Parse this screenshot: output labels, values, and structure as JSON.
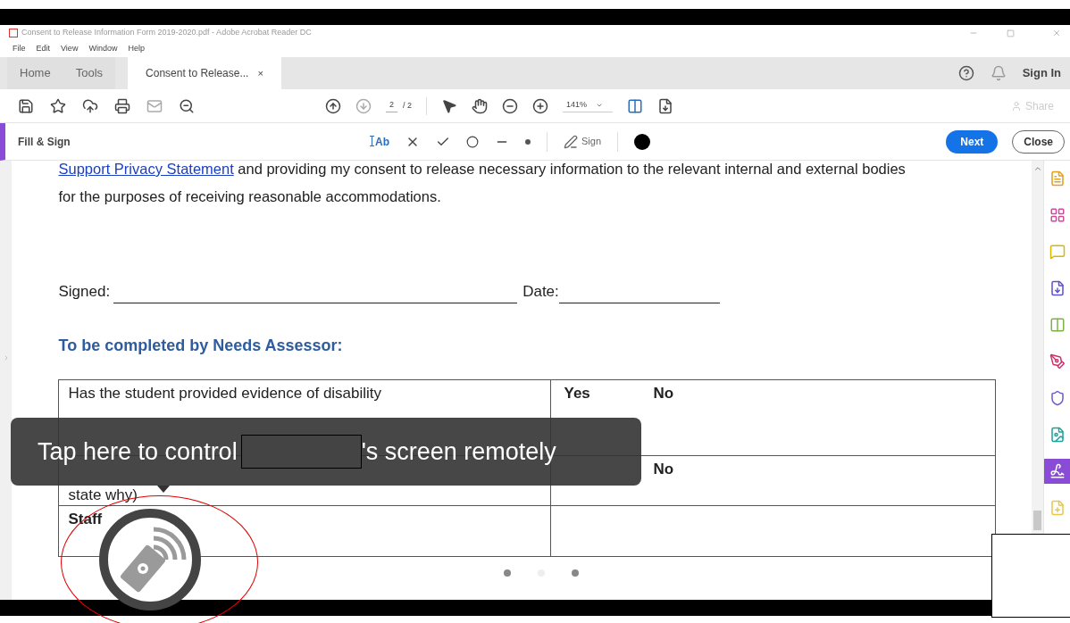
{
  "window": {
    "title": "Consent to Release Information Form 2019-2020.pdf - Adobe Acrobat Reader DC"
  },
  "menu": [
    "File",
    "Edit",
    "View",
    "Window",
    "Help"
  ],
  "tabs": [
    {
      "label": "Home",
      "selected": false
    },
    {
      "label": "Tools",
      "selected": false
    },
    {
      "label": "Consent to Release...",
      "selected": true,
      "close": "×"
    }
  ],
  "header": {
    "sign_in": "Sign In"
  },
  "toolbar": {
    "page_current": "2",
    "page_total": "/ 2",
    "zoom": "141%",
    "share": {
      "label": "Share",
      "disabled": true
    }
  },
  "fill_sign": {
    "title": "Fill & Sign",
    "text_tool": "Ab",
    "sign": "Sign",
    "next": "Next",
    "close": "Close"
  },
  "document": {
    "link": "Support Privacy Statement",
    "paragraph_rest": " and providing my consent to release necessary information to the relevant internal and external bodies for the purposes of receiving reasonable accommodations.",
    "signed_label": "Signed:",
    "date_label": "Date:",
    "heading": "To be completed by Needs Assessor:",
    "rows": [
      {
        "question": "Has the student provided evidence of disability",
        "kind": "question",
        "yes": "Yes",
        "no": "No"
      },
      {
        "question": "state why)",
        "kind": "question",
        "no": "No"
      },
      {
        "question": "Staff",
        "kind": "label"
      }
    ]
  },
  "page_dots": [
    {
      "selected": true
    },
    {
      "selected": false
    },
    {
      "selected": true
    }
  ],
  "tools_panel": [
    {
      "selected": false
    },
    {
      "selected": false
    },
    {
      "selected": false
    },
    {
      "selected": false
    },
    {
      "selected": false
    },
    {
      "selected": false
    },
    {
      "selected": false
    },
    {
      "selected": false
    },
    {
      "selected": true
    },
    {
      "selected": false
    }
  ],
  "overlay": {
    "message_before": "Tap here to control",
    "message_after": "'s screen remotely"
  }
}
